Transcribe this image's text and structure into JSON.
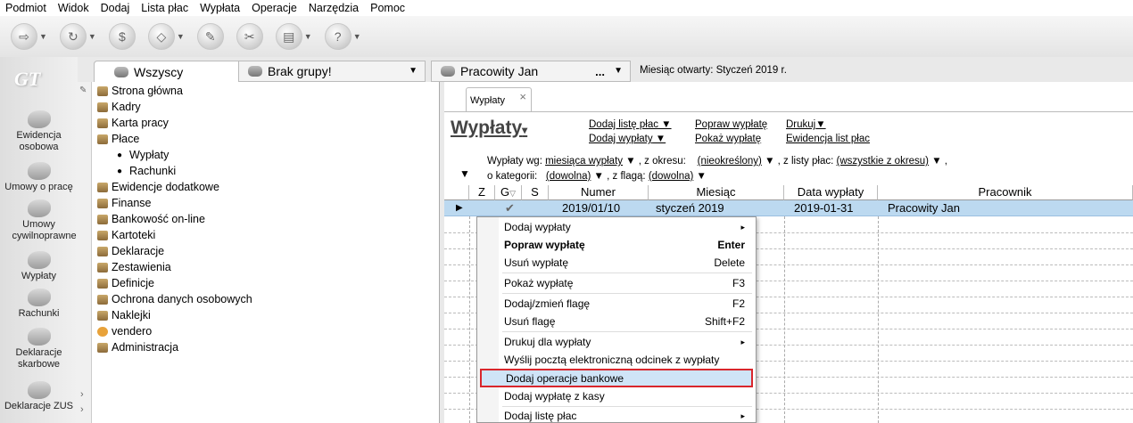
{
  "menubar": [
    "Podmiot",
    "Widok",
    "Dodaj",
    "Lista płac",
    "Wypłata",
    "Operacje",
    "Narzędzia",
    "Pomoc"
  ],
  "toolbar": {
    "buttons": [
      "open-icon",
      "refresh-icon",
      "payroll-icon",
      "eraser-icon",
      "tools-icon",
      "wizard-icon",
      "print-icon",
      "help-icon"
    ]
  },
  "rail": {
    "logo": "GT",
    "items": [
      {
        "label": "Ewidencja osobowa"
      },
      {
        "label": "Umowy o pracę"
      },
      {
        "label": "Umowy cywilnoprawne"
      },
      {
        "label": "Wypłaty"
      },
      {
        "label": "Rachunki"
      },
      {
        "label": "Deklaracje skarbowe"
      },
      {
        "label": "Deklaracje ZUS"
      }
    ]
  },
  "tabs": {
    "all": "Wszyscy",
    "group": "Brak grupy!",
    "employee": "Pracowity Jan",
    "employee_more": "...",
    "month_open": "Miesiąc otwarty: Styczeń 2019 r."
  },
  "tree": {
    "items": [
      "Strona główna",
      "Kadry",
      "Karta pracy",
      "Płace"
    ],
    "sub_items": [
      "Wypłaty",
      "Rachunki"
    ],
    "items_after": [
      "Ewidencje dodatkowe",
      "Finanse",
      "Bankowość on-line",
      "Kartoteki",
      "Deklaracje",
      "Zestawienia",
      "Definicje",
      "Ochrona danych osobowych",
      "Naklejki",
      "vendero",
      "Administracja"
    ]
  },
  "content": {
    "doc_tab": "Wypłaty",
    "title": "Wypłaty",
    "links": {
      "add_list": "Dodaj listę płac",
      "add_payment": "Dodaj wypłaty",
      "fix_payment": "Popraw wypłatę",
      "show_payment": "Pokaż wypłatę",
      "print": "Drukuj",
      "payroll_registry": "Ewidencja list płac"
    },
    "filters": {
      "label1": "Wypłaty wg:",
      "value1": "miesiąca wypłaty",
      "label2": ", z okresu:",
      "value2": "(nieokreślony)",
      "label3": ", z listy płac:",
      "value3": "(wszystkie z okresu)",
      "label4": "o kategorii:",
      "value4": "(dowolna)",
      "label5": ", z flagą:",
      "value5": "(dowolna)"
    },
    "columns": [
      "Z",
      "G",
      "S",
      "Numer",
      "Miesiąc",
      "Data wypłaty",
      "Pracownik"
    ],
    "rows": [
      {
        "numer": "2019/01/10",
        "miesiac": "styczeń 2019",
        "data": "2019-01-31",
        "pracownik": "Pracowity Jan",
        "g": "✔"
      }
    ]
  },
  "context_menu": {
    "items": [
      {
        "label": "Dodaj wypłaty",
        "shortcut": "",
        "submenu": true
      },
      {
        "label": "Popraw wypłatę",
        "shortcut": "Enter",
        "bold": true
      },
      {
        "label": "Usuń wypłatę",
        "shortcut": "Delete"
      },
      {
        "label": "Pokaż wypłatę",
        "shortcut": "F3"
      },
      {
        "label": "Dodaj/zmień flagę",
        "shortcut": "F2"
      },
      {
        "label": "Usuń flagę",
        "shortcut": "Shift+F2"
      },
      {
        "label": "Drukuj dla wypłaty",
        "shortcut": "",
        "submenu": true
      },
      {
        "label": "Wyślij pocztą elektroniczną odcinek z wypłaty",
        "shortcut": ""
      },
      {
        "label": "Dodaj operacje bankowe",
        "shortcut": "",
        "highlighted": true
      },
      {
        "label": "Dodaj wypłatę z kasy",
        "shortcut": ""
      },
      {
        "label": "Dodaj listę płac",
        "shortcut": "",
        "submenu": true
      }
    ],
    "submenu_arrow": "▸"
  },
  "colors": {
    "selected_row": "#bcd9f0",
    "highlight_border": "#d9262c"
  }
}
